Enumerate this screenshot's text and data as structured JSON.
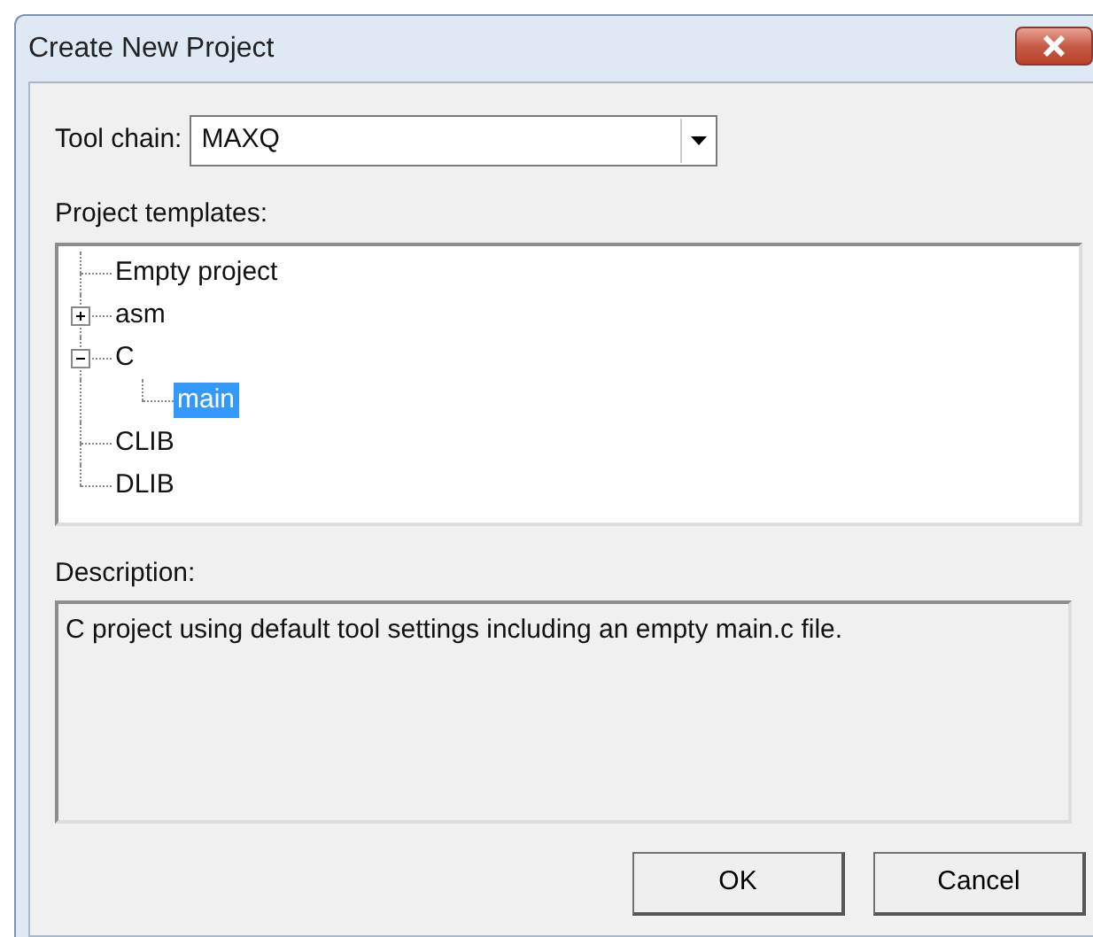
{
  "window": {
    "title": "Create New Project"
  },
  "tool_chain": {
    "label": "Tool chain:",
    "value": "MAXQ"
  },
  "templates": {
    "label": "Project templates:",
    "items": [
      {
        "label": "Empty project",
        "selected": false
      },
      {
        "label": "asm",
        "selected": false,
        "expanded": false
      },
      {
        "label": "C",
        "selected": false,
        "expanded": true,
        "children": [
          {
            "label": "main",
            "selected": true
          }
        ]
      },
      {
        "label": "CLIB",
        "selected": false
      },
      {
        "label": "DLIB",
        "selected": false
      }
    ]
  },
  "description": {
    "label": "Description:",
    "value": "C project using default tool settings including an empty main.c file."
  },
  "buttons": [
    "OK",
    "Cancel"
  ]
}
